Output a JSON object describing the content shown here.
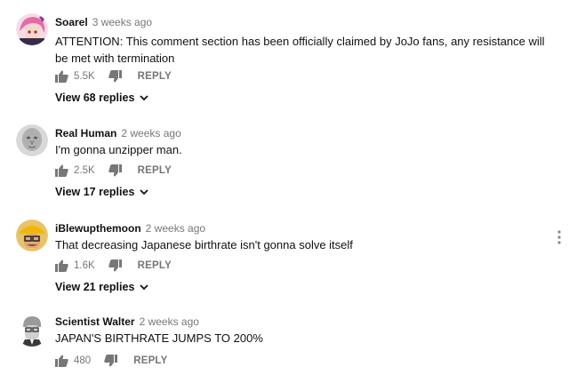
{
  "comments": [
    {
      "author": "Soarel",
      "time": "3 weeks ago",
      "text": "ATTENTION: This comment section has been officially claimed by JoJo fans, any resistance will be met with termination",
      "likes": "5.5K",
      "reply_label": "REPLY",
      "view_replies": "View 68 replies",
      "avatar_icon": "anime-avatar-icon"
    },
    {
      "author": "Real Human",
      "time": "2 weeks ago",
      "text": "I'm gonna unzipper man.",
      "likes": "2.5K",
      "reply_label": "REPLY",
      "view_replies": "View 17 replies",
      "avatar_icon": "gray-face-avatar-icon"
    },
    {
      "author": "iBlewupthemoon",
      "time": "2 weeks ago",
      "text": "That decreasing Japanese birthrate isn't gonna solve itself",
      "likes": "1.6K",
      "reply_label": "REPLY",
      "view_replies": "View 21 replies",
      "avatar_icon": "hardhat-avatar-icon"
    },
    {
      "author": "Scientist Walter",
      "time": "2 weeks ago",
      "text": "JAPAN'S BIRTHRATE JUMPS TO 200%",
      "likes": "480",
      "reply_label": "REPLY",
      "avatar_icon": "scientist-avatar-icon"
    }
  ],
  "icons": {
    "like": "thumbs-up-icon",
    "dislike": "thumbs-down-icon",
    "expand": "chevron-down-icon",
    "menu": "vertical-dots-icon"
  },
  "colors": {
    "text": "#111111",
    "meta": "#777777",
    "background": "#ffffff"
  }
}
